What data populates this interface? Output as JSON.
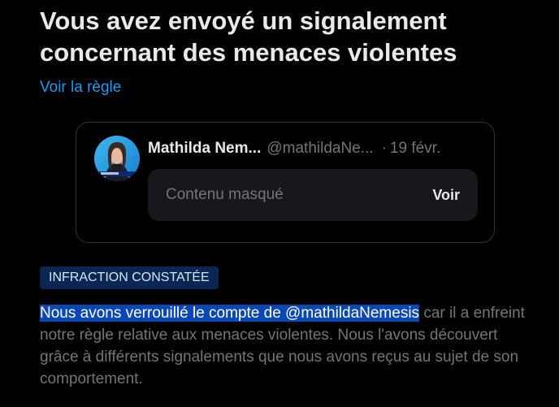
{
  "report": {
    "title": "Vous avez envoyé un signalement concernant des menaces violentes",
    "rule_link": "Voir la règle"
  },
  "tweet": {
    "display_name": "Mathilda Nem...",
    "handle": "@mathildaNe...",
    "separator": "·",
    "date": "19 févr.",
    "hidden_label": "Contenu masqué",
    "view_button": "Voir"
  },
  "result": {
    "badge": "INFRACTION CONSTATÉE",
    "highlighted_text": "Nous avons verrouillé le compte de @mathildaNemesis",
    "rest_text": " car il a enfreint notre règle relative aux menaces violentes. Nous l'avons découvert grâce à différents signalements que nous avons reçus au sujet de son comportement."
  },
  "colors": {
    "background": "#000000",
    "text_primary": "#e7e9ea",
    "text_secondary": "#71767b",
    "link": "#1d9bf0",
    "badge_bg": "#0a2753",
    "selection": "#0b48b4"
  }
}
